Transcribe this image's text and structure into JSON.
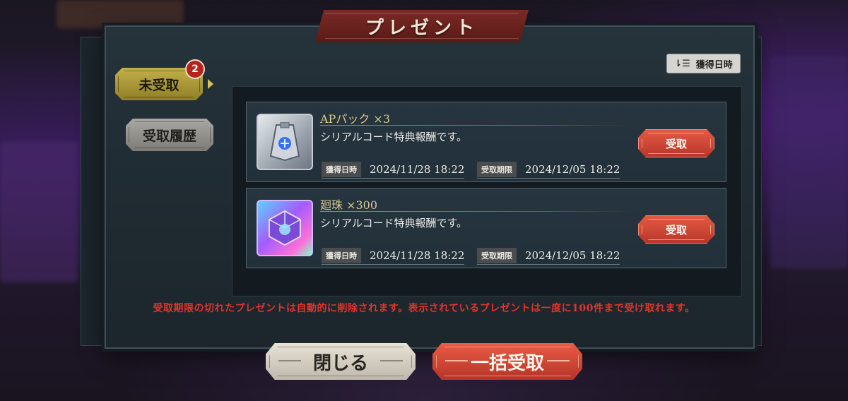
{
  "dialog": {
    "title": "プレゼント"
  },
  "tabs": {
    "unclaimed_label": "未受取",
    "unclaimed_badge": "2",
    "history_label": "受取履歴"
  },
  "sort": {
    "icon": "sort-icon",
    "label": "獲得日時"
  },
  "items": [
    {
      "name": "APパック ×3",
      "description": "シリアルコード特典報酬です。",
      "acquired_label": "獲得日時",
      "acquired_value": "2024/11/28 18:22",
      "deadline_label": "受取期限",
      "deadline_value": "2024/12/05 18:22",
      "claim_label": "受取",
      "icon": "ap-pack-icon"
    },
    {
      "name": "廻珠 ×300",
      "description": "シリアルコード特典報酬です。",
      "acquired_label": "獲得日時",
      "acquired_value": "2024/11/28 18:22",
      "deadline_label": "受取期限",
      "deadline_value": "2024/12/05 18:22",
      "claim_label": "受取",
      "icon": "orb-cube-icon"
    }
  ],
  "notice": "受取期限の切れたプレゼントは自動的に削除されます。表示されているプレゼントは一度に100件まで受け取れます。",
  "buttons": {
    "close_label": "閉じる",
    "claim_all_label": "一括受取"
  },
  "colors": {
    "accent_red": "#d8412f",
    "tab_gold": "#c4b04a",
    "notice_red": "#e2332d"
  }
}
